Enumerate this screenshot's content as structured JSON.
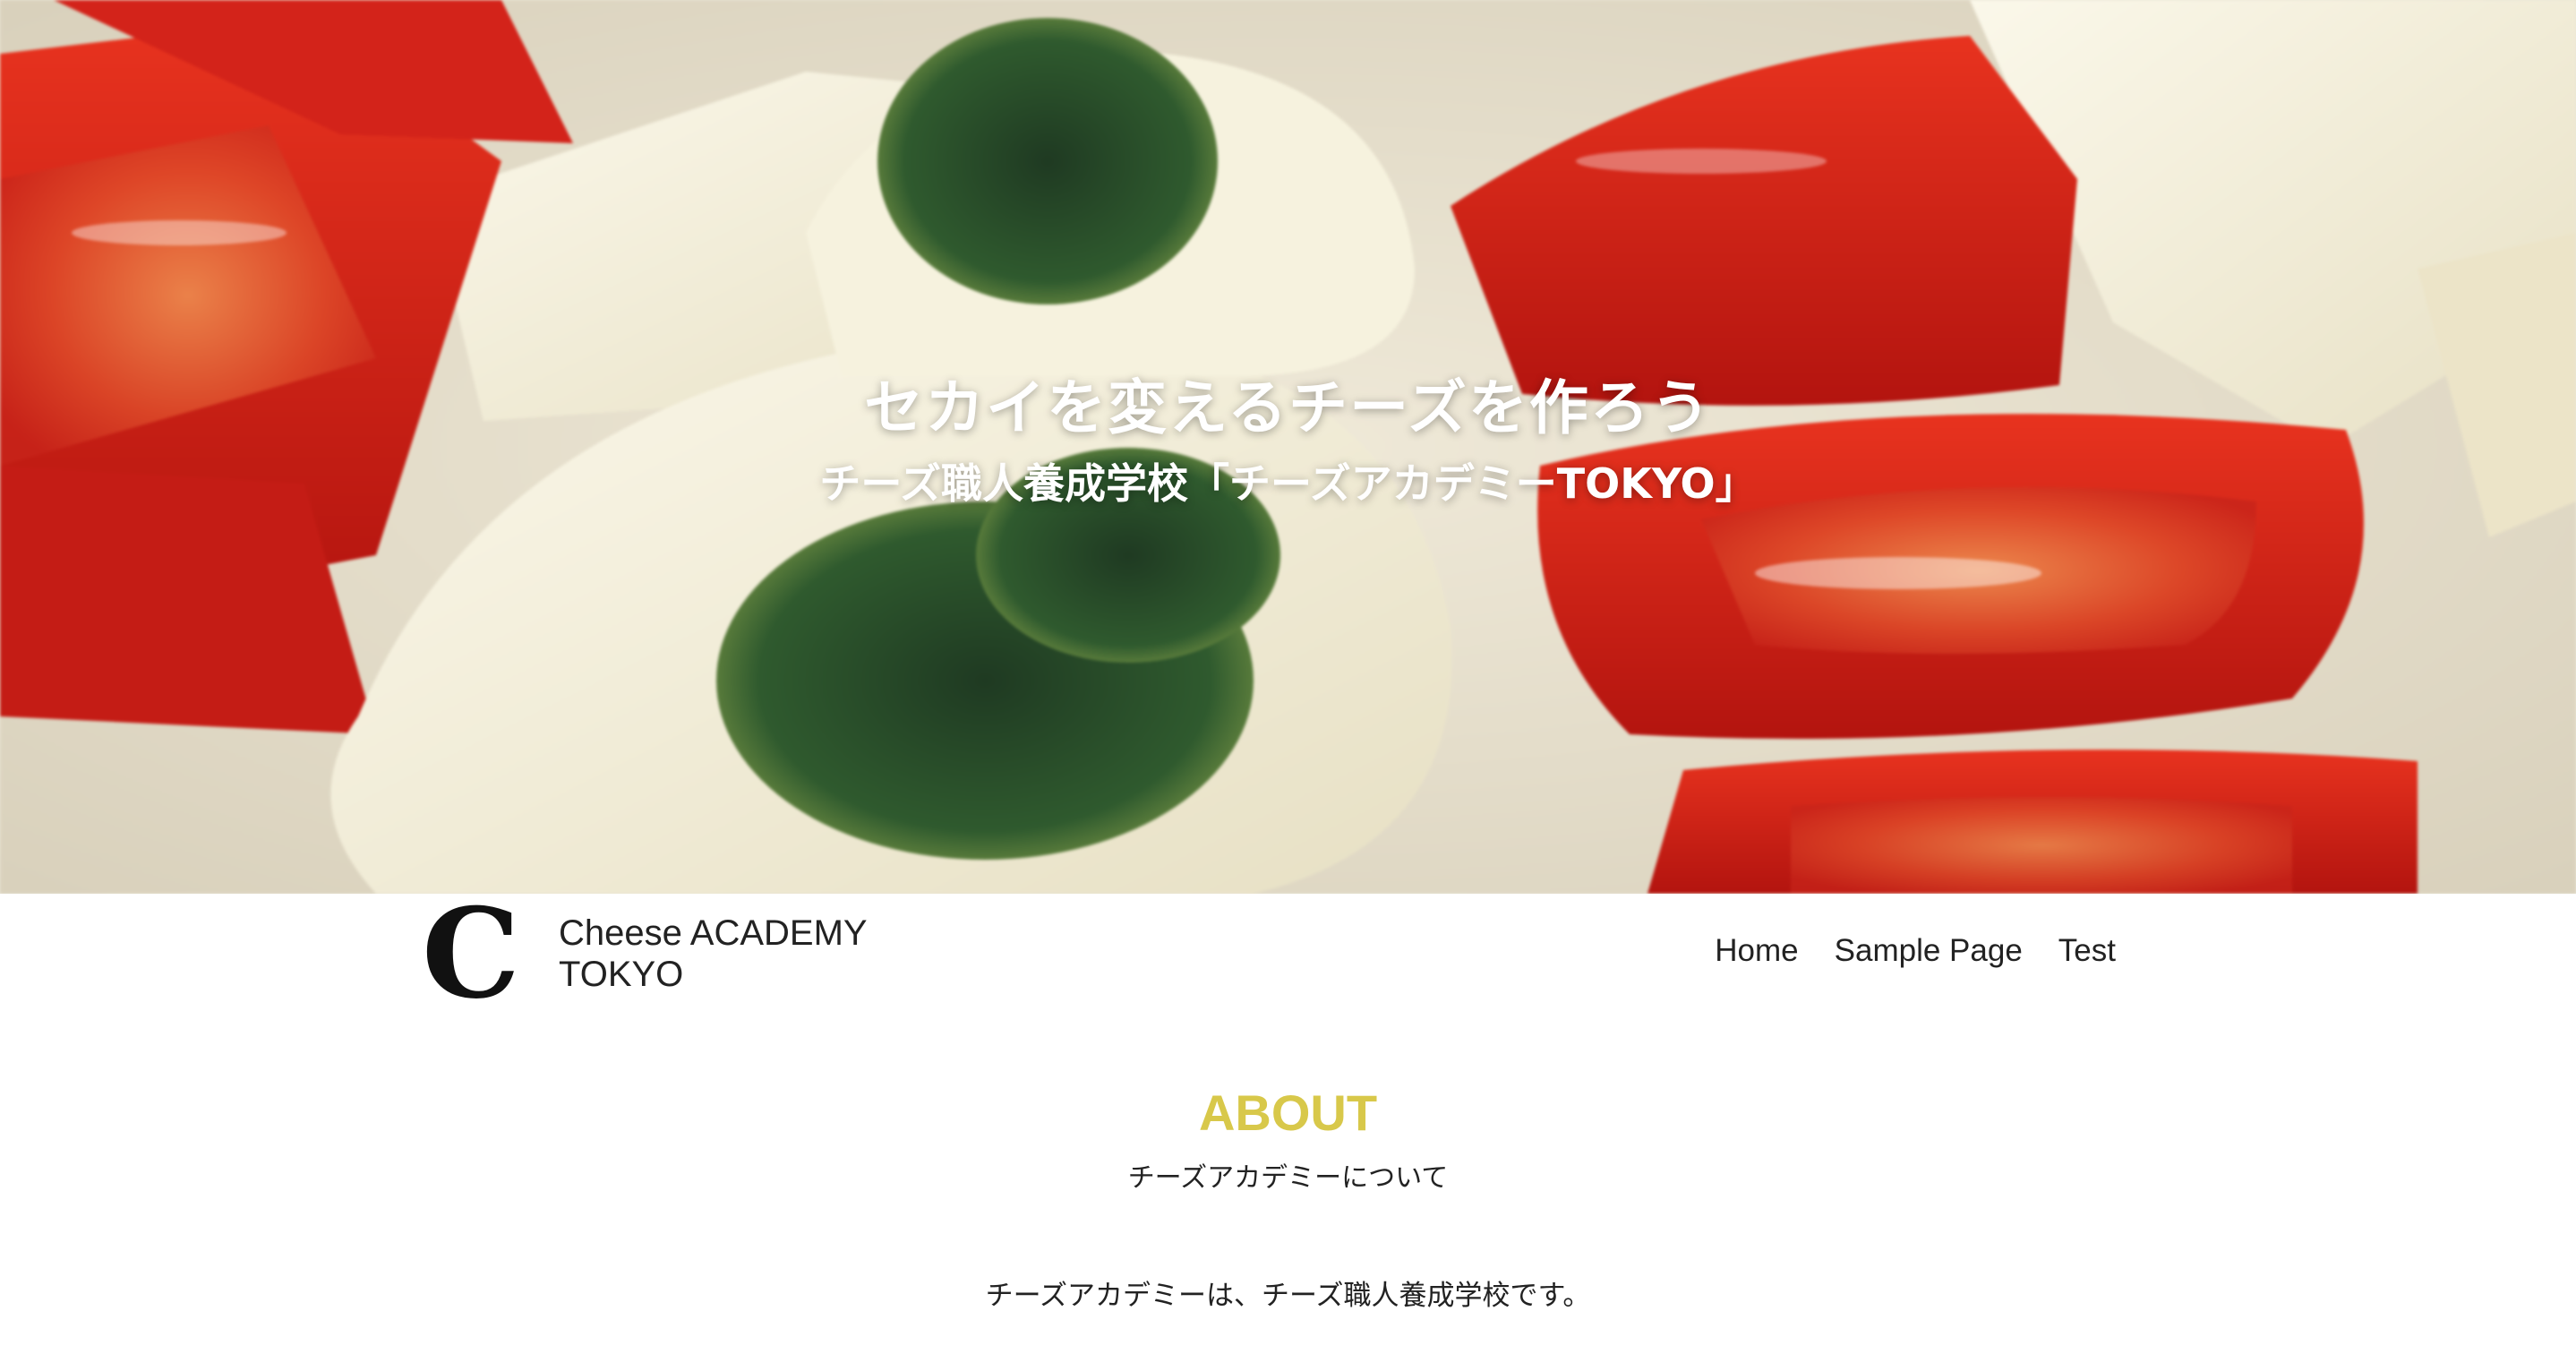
{
  "hero": {
    "title": "セカイを変えるチーズを作ろう",
    "subtitle": "チーズ職人養成学校「チーズアカデミーTOKYO」"
  },
  "header": {
    "logo_mark": "C",
    "logo_line1": "Cheese ACADEMY",
    "logo_line2": "TOKYO",
    "nav": [
      {
        "label": "Home"
      },
      {
        "label": "Sample Page"
      },
      {
        "label": "Test"
      }
    ]
  },
  "about": {
    "heading": "ABOUT",
    "subheading": "チーズアカデミーについて",
    "body": "チーズアカデミーは、チーズ職人養成学校です。"
  },
  "colors": {
    "accent": "#d8c84a",
    "tomato": "#d9261c",
    "cheese": "#f4f0dc",
    "pesto": "#2f4a2a"
  },
  "icons": {
    "hero_image": "cheese-tomato-photo",
    "logo": "cheese-academy-logo"
  }
}
